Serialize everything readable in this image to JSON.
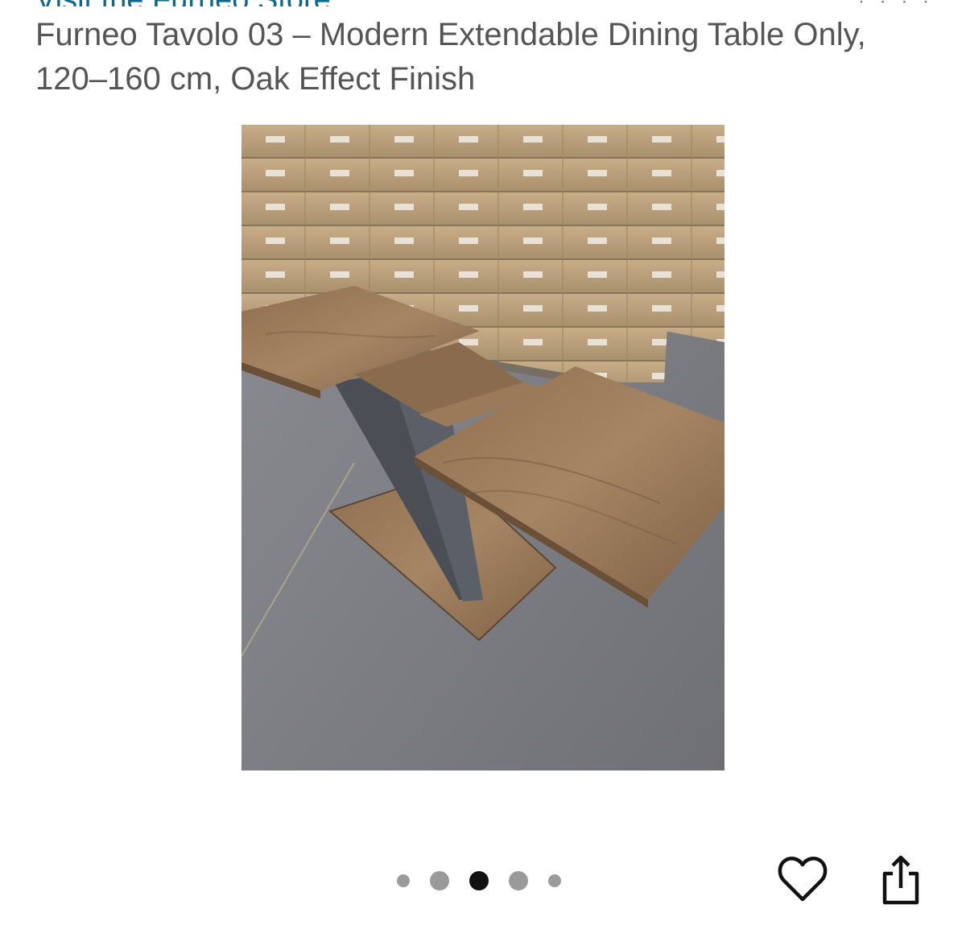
{
  "header": {
    "store_link": "Visit the Furneo Store",
    "top_right": "· · · ·"
  },
  "product": {
    "title": "Furneo Tavolo 03 – Modern Extendable Dining Table Only, 120–160 cm, Oak Effect Finish"
  },
  "gallery": {
    "total_images": 5,
    "active_index": 2
  },
  "actions": {
    "wishlist_icon": "heart-outline-icon",
    "share_icon": "share-icon"
  },
  "colors": {
    "title_text": "#555555",
    "link_text": "#0d6a8c",
    "active_dot": "#111111",
    "inactive_dot": "#9a9a9a"
  }
}
